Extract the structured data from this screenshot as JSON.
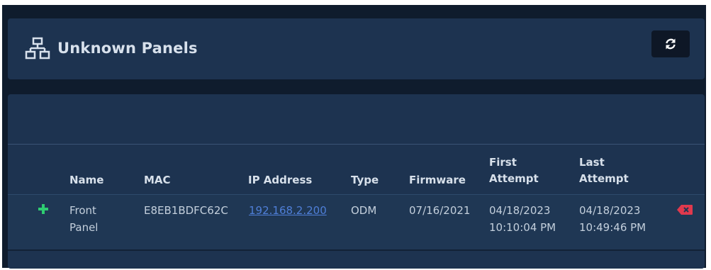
{
  "header": {
    "title": "Unknown Panels",
    "title_icon": "network-icon",
    "refresh_icon": "refresh-icon"
  },
  "table": {
    "columns": {
      "name": "Name",
      "mac": "MAC",
      "ip": "IP Address",
      "type": "Type",
      "firmware": "Firmware",
      "first_attempt_1": "First",
      "first_attempt_2": "Attempt",
      "last_attempt_1": "Last",
      "last_attempt_2": "Attempt"
    },
    "rows": [
      {
        "name_1": "Front",
        "name_2": "Panel",
        "mac": "E8EB1BDFC62C",
        "ip": "192.168.2.200",
        "type": "ODM",
        "firmware": "07/16/2021",
        "first_date": "04/18/2023",
        "first_time": "10:10:04 PM",
        "last_date": "04/18/2023",
        "last_time": "10:49:46 PM",
        "add_icon": "plus-icon",
        "delete_icon": "delete-icon"
      }
    ]
  },
  "colors": {
    "background": "#0f1c2d",
    "card": "#1d3350",
    "add": "#2ecc71",
    "delete": "#e0394d",
    "link": "#4f7fd8"
  }
}
